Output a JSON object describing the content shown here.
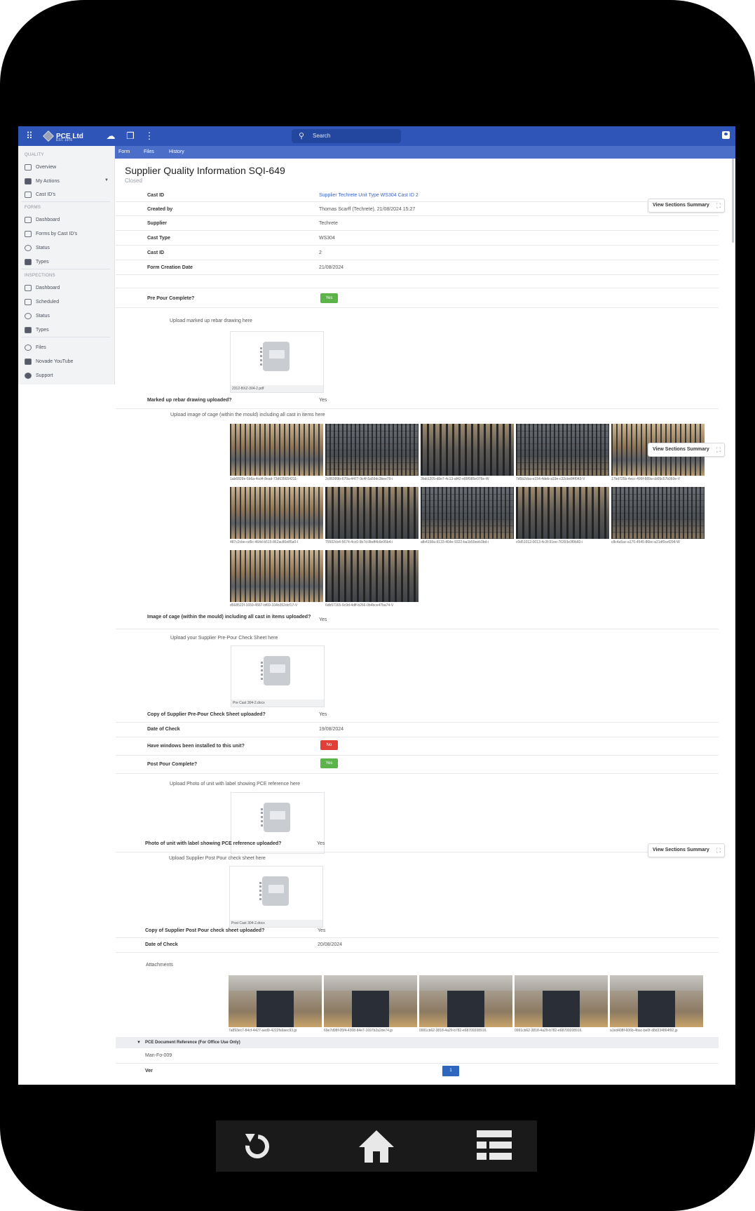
{
  "app": {
    "brand": "PCE Ltd",
    "brand_sub": "EST. 1978",
    "search_placeholder": "Search"
  },
  "tabs": [
    "Form",
    "Files",
    "History"
  ],
  "sidebar": {
    "quality_head": "QUALITY",
    "quality": [
      "Overview",
      "My Actions",
      "Cast ID's"
    ],
    "forms_head": "FORMS",
    "forms": [
      "Dashboard",
      "Forms by Cast ID's",
      "Status",
      "Types"
    ],
    "inspections_head": "INSPECTIONS",
    "inspections": [
      "Dashboard",
      "Scheduled",
      "Status",
      "Types"
    ],
    "other": [
      "Files",
      "Novade YouTube",
      "Support"
    ]
  },
  "page": {
    "title": "Supplier Quality Information SQI-649",
    "status": "Closed"
  },
  "view_summary": "View Sections Summary",
  "fields": {
    "cast_id_label": "Cast ID",
    "cast_id_value": "Supplier Techrete Unit Type WS304 Cast ID 2",
    "created_by_label": "Created by",
    "created_by_value": "Thomas Scarff (Techrete), 21/08/2024 15:27",
    "supplier_label": "Supplier",
    "supplier_value": "Techrete",
    "cast_type_label": "Cast Type",
    "cast_type_value": "WS304",
    "cast_id2_label": "Cast ID",
    "cast_id2_value": "2",
    "form_date_label": "Form Creation Date",
    "form_date_value": "21/08/2024"
  },
  "checks": {
    "pre_pour_label": "Pre Pour Complete?",
    "pre_pour_value": "Yes",
    "upload_rebar": "Upload marked up rebar drawing here",
    "rebar_file": "2312-BXZ-304-2.pdf",
    "rebar_uploaded_label": "Marked up rebar drawing uploaded?",
    "rebar_uploaded_value": "Yes",
    "upload_cage": "Upload image of cage (within the mould) including all cast in items here",
    "cage_uploaded_label": "Image of cage (within the mould) including all cast in items uploaded?",
    "cage_uploaded_value": "Yes",
    "upload_prepour_sheet": "Upload your Supplier Pre-Pour Check Sheet here",
    "prepour_file": "Pre Cast 304-2.docx",
    "prepour_copy_label": "Copy of Supplier Pre-Pour Check Sheet uploaded?",
    "prepour_copy_value": "Yes",
    "date_check_label": "Date of Check",
    "date_check_value": "19/08/2024",
    "windows_label": "Have windows been installed to this unit?",
    "windows_value": "No",
    "post_pour_label": "Post Pour Complete?",
    "post_pour_value": "Yes",
    "upload_photo_unit": "Upload Photo of unit with label showing PCE reference here",
    "photo_unit_label": "Photo of unit with label showing PCE reference uploaded?",
    "photo_unit_value": "Yes",
    "upload_postpour_sheet": "Upload Supplier Post Pour check sheet here",
    "postpour_file": "Post Cast 304-2.docx",
    "postpour_copy_label": "Copy of Supplier Post Pour check sheet uploaded?",
    "postpour_copy_value": "Yes",
    "date_check2_label": "Date of Check",
    "date_check2_value": "20/08/2024",
    "attachments_label": "Attachments"
  },
  "cage_images": [
    "1ab6829e-5b6a-4cd4-8ead-73d635654211-",
    "2c86999b-670a-4477-9c4f-5a59dc3bee79-i",
    "3fab1205-d8e7-4c13-af42-e89f985e076e-W",
    "7d5b2cba-e154-4deb-a19e-c32cbe84f043-V",
    "17bd725b-4ecc-496f-889a-cb09c57b060e-V",
    "487c2cbe-cd5c-464d-b515-862ac80e85a0-l",
    "75502cb4-5674-4cc0-9b7d-8bdf4b9e95b4-i",
    "afb4158a-9133-464e-9322-ba1b59eeb3bd-i",
    "c0d51012-0013-4c3f-91ee-76393e3f9b60-i",
    "c8c4a5ac-a170-4545-86bc-a31df0cef294-W",
    "d568522f-1659-4567-bf69-104b352dcf17-V",
    "6db57165-9c9d-4dff-b266-0b4bce47ba74-V"
  ],
  "attachment_images": [
    "7a893ec7-84cf-4427-aed9-4222fa9aec93.jp",
    "69e7d98f-05f4-4308-84e7-1697b2a2de74.jp",
    "0991cb62-3818-4a29-b782-e68709208916.",
    "0991cb62-3818-4a29-b782-e68709208916.",
    "a1ed408f-606b-4bac-be0f-d8d334864f92.jp"
  ],
  "pce_section": {
    "title": "PCE Document Reference (For Office Use Only)",
    "doc_ref": "Man-Fo-009",
    "ver_label": "Ver",
    "ver_value": "1"
  }
}
